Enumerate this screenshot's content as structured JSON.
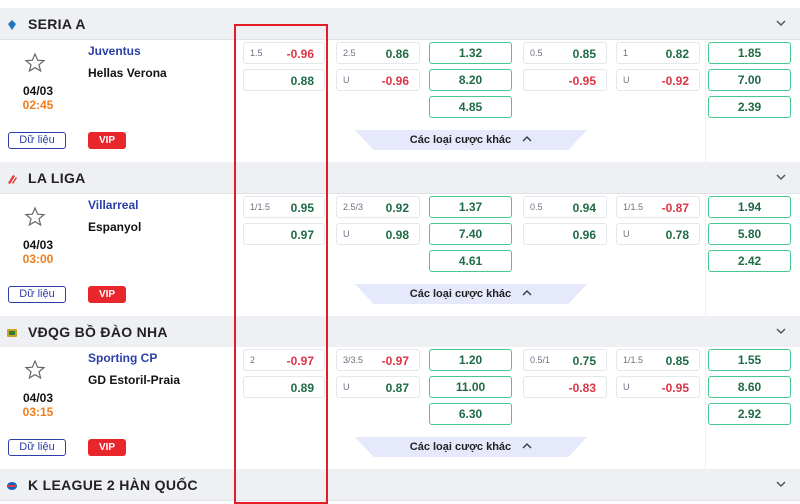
{
  "leagues": [
    {
      "name": "SERIA A",
      "match": {
        "home": "Juventus",
        "away": "Hellas Verona",
        "date": "04/03",
        "time": "02:45",
        "hdp": [
          {
            "line": "1.5",
            "price": "-0.96",
            "neg": true
          },
          {
            "line": "",
            "price": "0.88",
            "neg": false
          }
        ],
        "ou": [
          {
            "line": "2.5",
            "price": "0.86",
            "neg": false
          },
          {
            "line": "U",
            "price": "-0.96",
            "neg": true
          }
        ],
        "x12": [
          "1.32",
          "8.20",
          "4.85"
        ],
        "hdp_h1": [
          {
            "line": "0.5",
            "price": "0.85",
            "neg": false
          },
          {
            "line": "",
            "price": "-0.95",
            "neg": true
          }
        ],
        "ou_h1": [
          {
            "line": "1",
            "price": "0.82",
            "neg": false
          },
          {
            "line": "U",
            "price": "-0.92",
            "neg": true
          }
        ],
        "x12_h1": [
          "1.85",
          "7.00",
          "2.39"
        ]
      }
    },
    {
      "name": "LA LIGA",
      "match": {
        "home": "Villarreal",
        "away": "Espanyol",
        "date": "04/03",
        "time": "03:00",
        "hdp": [
          {
            "line": "1/1.5",
            "price": "0.95",
            "neg": false
          },
          {
            "line": "",
            "price": "0.97",
            "neg": false
          }
        ],
        "ou": [
          {
            "line": "2.5/3",
            "price": "0.92",
            "neg": false
          },
          {
            "line": "U",
            "price": "0.98",
            "neg": false
          }
        ],
        "x12": [
          "1.37",
          "7.40",
          "4.61"
        ],
        "hdp_h1": [
          {
            "line": "0.5",
            "price": "0.94",
            "neg": false
          },
          {
            "line": "",
            "price": "0.96",
            "neg": false
          }
        ],
        "ou_h1": [
          {
            "line": "1/1.5",
            "price": "-0.87",
            "neg": true
          },
          {
            "line": "U",
            "price": "0.78",
            "neg": false
          }
        ],
        "x12_h1": [
          "1.94",
          "5.80",
          "2.42"
        ]
      }
    },
    {
      "name": "VĐQG BỒ ĐÀO NHA",
      "match": {
        "home": "Sporting CP",
        "away": "GD Estoril-Praia",
        "date": "04/03",
        "time": "03:15",
        "hdp": [
          {
            "line": "2",
            "price": "-0.97",
            "neg": true
          },
          {
            "line": "",
            "price": "0.89",
            "neg": false
          }
        ],
        "ou": [
          {
            "line": "3/3.5",
            "price": "-0.97",
            "neg": true
          },
          {
            "line": "U",
            "price": "0.87",
            "neg": false
          }
        ],
        "x12": [
          "1.20",
          "11.00",
          "6.30"
        ],
        "hdp_h1": [
          {
            "line": "0.5/1",
            "price": "0.75",
            "neg": false
          },
          {
            "line": "",
            "price": "-0.83",
            "neg": true
          }
        ],
        "ou_h1": [
          {
            "line": "1/1.5",
            "price": "0.85",
            "neg": false
          },
          {
            "line": "U",
            "price": "-0.95",
            "neg": true
          }
        ],
        "x12_h1": [
          "1.55",
          "8.60",
          "2.92"
        ]
      }
    },
    {
      "name": "K LEAGUE 2 HÀN QUỐC"
    }
  ],
  "labels": {
    "data_button": "Dữ liệu",
    "vip": "VIP",
    "more_bets": "Các loại cược khác"
  },
  "icons": {
    "star": "star-icon",
    "chevron": "chevron-down-icon",
    "caret": "chevron-up-icon"
  },
  "colors": {
    "accent": "#2b3fa6",
    "positive": "#1f6b46",
    "negative": "#dc3545",
    "time": "#f07d1d",
    "highlight": "#e11d2a",
    "vip": "#e8262c"
  }
}
